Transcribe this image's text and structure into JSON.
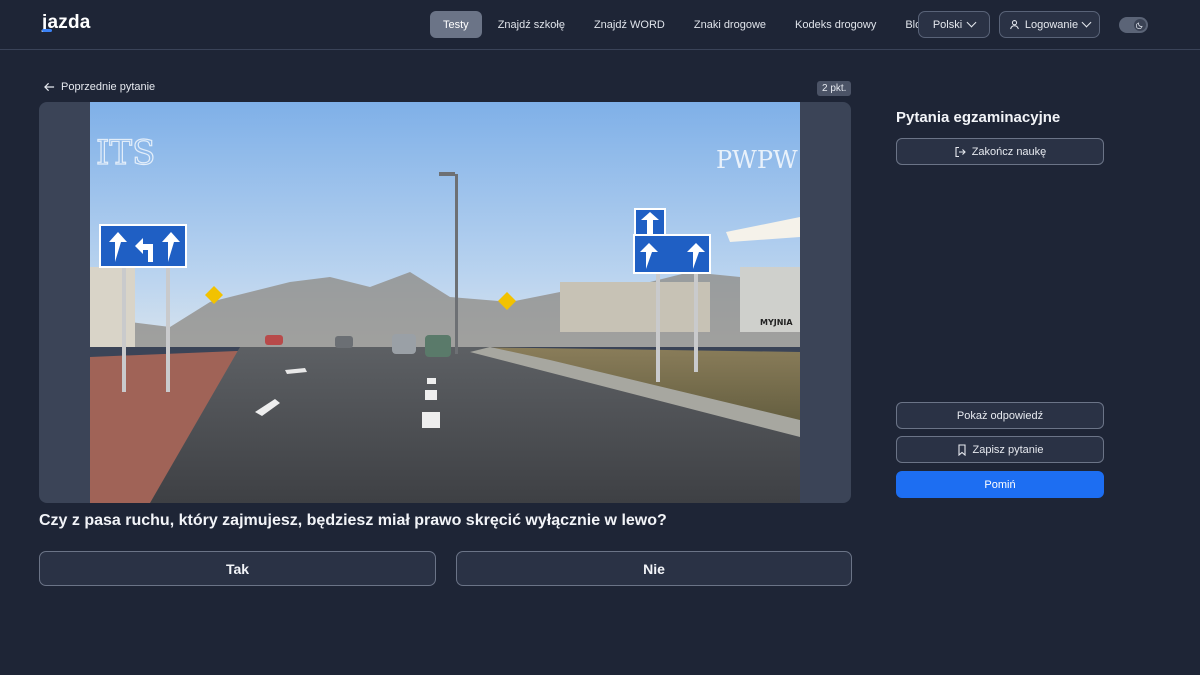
{
  "header": {
    "logo_text": "jazda",
    "nav": [
      {
        "label": "Testy",
        "active": true
      },
      {
        "label": "Znajdź szkołę",
        "active": false
      },
      {
        "label": "Znajdź WORD",
        "active": false
      },
      {
        "label": "Znaki drogowe",
        "active": false
      },
      {
        "label": "Kodeks drogowy",
        "active": false
      },
      {
        "label": "Blog",
        "active": false
      }
    ],
    "language_label": "Polski",
    "login_label": "Logowanie",
    "theme_toggle_icon": "moon-icon"
  },
  "main": {
    "back_label": "Poprzednie pytanie",
    "points_badge": "2 pkt.",
    "media": {
      "watermark_right": "PWPW",
      "watermark_left": "ITS",
      "car_wash_label": "MYJNIA"
    },
    "question": "Czy z pasa ruchu, który zajmujesz, będziesz miał prawo skręcić wyłącznie w lewo?",
    "answers": [
      "Tak",
      "Nie"
    ]
  },
  "sidebar": {
    "title": "Pytania egzaminacyjne",
    "finish_label": "Zakończ naukę",
    "show_answer_label": "Pokaż odpowiedź",
    "save_label": "Zapisz pytanie",
    "skip_label": "Pomiń"
  },
  "colors": {
    "background": "#1e2536",
    "accent": "#1d6ef2",
    "active_nav": "#6b7487"
  }
}
